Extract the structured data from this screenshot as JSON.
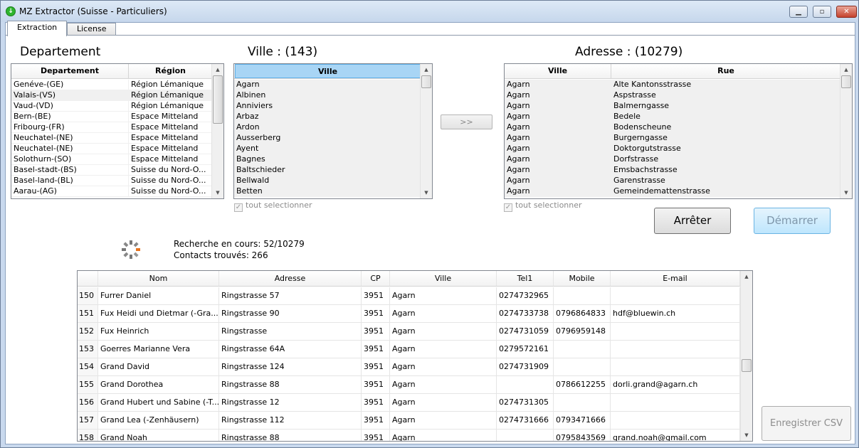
{
  "window": {
    "title": "MZ Extractor (Suisse - Particuliers)",
    "icon": "app-logo-icon"
  },
  "tabs": [
    {
      "label": "Extraction",
      "active": true
    },
    {
      "label": "License",
      "active": false
    }
  ],
  "departement": {
    "heading": "Departement",
    "columns": [
      "Departement",
      "Région"
    ],
    "rows": [
      [
        "Genéve-(GE)",
        "Région Lémanique"
      ],
      [
        "Valais-(VS)",
        "Région Lémanique"
      ],
      [
        "Vaud-(VD)",
        "Région Lémanique"
      ],
      [
        "Bern-(BE)",
        "Espace Mitteland"
      ],
      [
        "Fribourg-(FR)",
        "Espace Mitteland"
      ],
      [
        "Neuchatel-(NE)",
        "Espace Mitteland"
      ],
      [
        "Neuchatel-(NE)",
        "Espace Mitteland"
      ],
      [
        "Solothurn-(SO)",
        "Espace Mitteland"
      ],
      [
        "Basel-stadt-(BS)",
        "Suisse du Nord-O..."
      ],
      [
        "Basel-land-(BL)",
        "Suisse du Nord-O..."
      ],
      [
        "Aarau-(AG)",
        "Suisse du Nord-O..."
      ]
    ]
  },
  "ville": {
    "heading": "Ville : (143)",
    "column": "Ville",
    "rows": [
      "Agarn",
      "Albinen",
      "Anniviers",
      "Arbaz",
      "Ardon",
      "Ausserberg",
      "Ayent",
      "Bagnes",
      "Baltschieder",
      "Bellwald",
      "Betten"
    ],
    "select_all": "tout selectionner"
  },
  "transfer_button": ">>",
  "adresse": {
    "heading": "Adresse : (10279)",
    "columns": [
      "Ville",
      "Rue"
    ],
    "rows": [
      [
        "Agarn",
        "Alte Kantonsstrasse"
      ],
      [
        "Agarn",
        "Aspstrasse"
      ],
      [
        "Agarn",
        "Balmerngasse"
      ],
      [
        "Agarn",
        "Bedele"
      ],
      [
        "Agarn",
        "Bodenscheune"
      ],
      [
        "Agarn",
        "Burgerngasse"
      ],
      [
        "Agarn",
        "Doktorgutstrasse"
      ],
      [
        "Agarn",
        "Dorfstrasse"
      ],
      [
        "Agarn",
        "Emsbachstrasse"
      ],
      [
        "Agarn",
        "Garenstrasse"
      ],
      [
        "Agarn",
        "Gemeindemattenstrasse"
      ]
    ],
    "select_all": "tout selectionner"
  },
  "buttons": {
    "stop": "Arrêter",
    "start": "Démarrer",
    "save_csv": "Enregistrer CSV"
  },
  "status": {
    "search": "Recherche en cours: 52/10279",
    "contacts": "Contacts trouvés: 266"
  },
  "results": {
    "columns": [
      "",
      "Nom",
      "Adresse",
      "CP",
      "Ville",
      "Tel1",
      "Mobile",
      "E-mail"
    ],
    "rows": [
      [
        "150",
        "Furrer Daniel",
        "Ringstrasse 57",
        "3951",
        "Agarn",
        "0274732965",
        "",
        ""
      ],
      [
        "151",
        "Fux Heidi und Dietmar (-Gra...",
        "Ringstrasse 90",
        "3951",
        "Agarn",
        "0274733738",
        "0796864833",
        "hdf@bluewin.ch"
      ],
      [
        "152",
        "Fux Heinrich",
        "Ringstrasse",
        "3951",
        "Agarn",
        "0274731059",
        "0796959148",
        ""
      ],
      [
        "153",
        "Goerres Marianne Vera",
        "Ringstrasse 64A",
        "3951",
        "Agarn",
        "0279572161",
        "",
        ""
      ],
      [
        "154",
        "Grand David",
        "Ringstrasse 124",
        "3951",
        "Agarn",
        "0274731909",
        "",
        ""
      ],
      [
        "155",
        "Grand Dorothea",
        "Ringstrasse 88",
        "3951",
        "Agarn",
        "",
        "0786612255",
        "dorli.grand@agarn.ch"
      ],
      [
        "156",
        "Grand Hubert und Sabine (-T...",
        "Ringstrasse 12",
        "3951",
        "Agarn",
        "0274731305",
        "",
        ""
      ],
      [
        "157",
        "Grand Lea (-Zenhäusern)",
        "Ringstrasse 112",
        "3951",
        "Agarn",
        "0274731666",
        "0793471666",
        ""
      ],
      [
        "158",
        "Grand Noah",
        "Ringstrasse 88",
        "3951",
        "Agarn",
        "",
        "0795843569",
        "grand.noah@gmail.com"
      ]
    ]
  },
  "colors": {
    "accent": "#bee6fd",
    "title_bar": "#c6d7ec",
    "selected_header": "#a8d5f5",
    "spinner_accent": "#e8731e"
  }
}
